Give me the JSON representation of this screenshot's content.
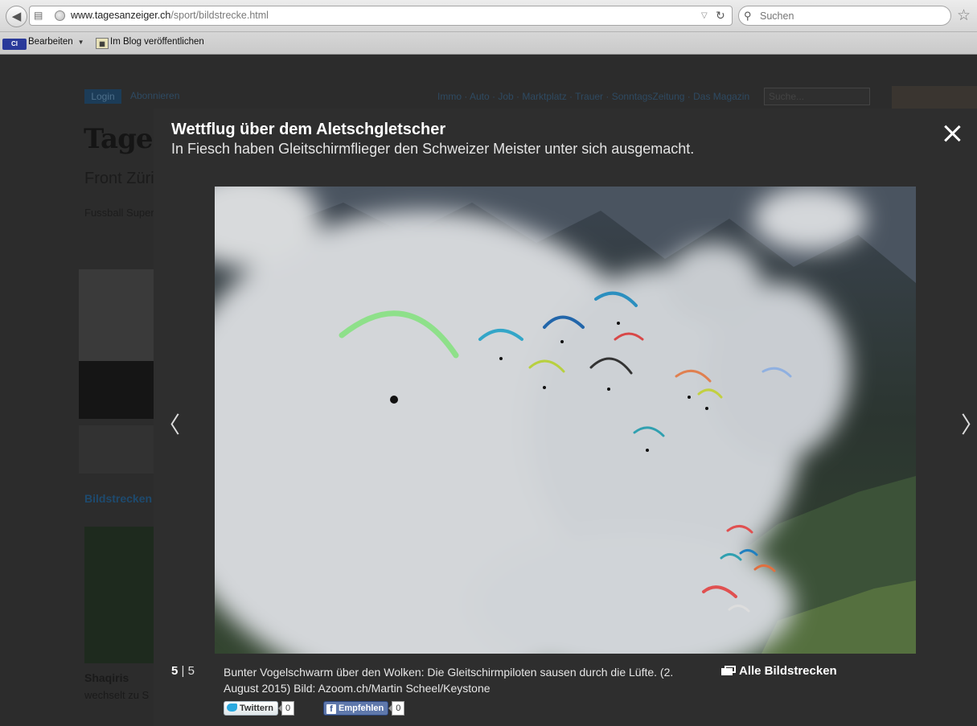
{
  "browser": {
    "url_domain": "www.tagesanzeiger.ch",
    "url_path": "/sport/bildstrecke.html",
    "search_placeholder": "Suchen",
    "bookmarks": [
      {
        "label": "Bearbeiten",
        "icon": "ci-icon"
      },
      {
        "label": "Im Blog veröffentlichen",
        "icon": "blog-icon"
      }
    ]
  },
  "background_page": {
    "login": "Login",
    "abonnieren": "Abonnieren",
    "topnav": "Immo · Auto · Job · Marktplatz · Trauer · SonntagsZeitung · Das Magazin",
    "search_placeholder": "Suche...",
    "logo": "Tages",
    "front_nav": "Front  Zürich",
    "sub_nav": "Fussball  Super",
    "section_label": "Bildstrecken",
    "teaser_title": "Shaqiris",
    "teaser_text": "wechselt zu S"
  },
  "lightbox": {
    "title": "Wettflug über dem Aletschgletscher",
    "subtitle": "In Fiesch haben Gleitschirmflieger den Schweizer Meister unter sich ausgemacht.",
    "current": "5",
    "separator": "|",
    "total": "5",
    "caption": "Bunter Vogelschwarm über den Wolken: Die Gleitschirmpiloten sausen durch die Lüfte. (2. August 2015) Bild: Azoom.ch/Martin Scheel/Keystone",
    "all_galleries": "Alle Bildstrecken",
    "prev_glyph": "〈",
    "next_glyph": "〉",
    "share": {
      "twitter_label": "Twittern",
      "twitter_count": "0",
      "facebook_label": "Empfehlen",
      "facebook_count": "0"
    }
  },
  "colors": {
    "overlay": "#2e2e2e",
    "link_blue": "#1e4a6e",
    "facebook": "#5f78ab",
    "twitter": "#2aa9e0"
  }
}
